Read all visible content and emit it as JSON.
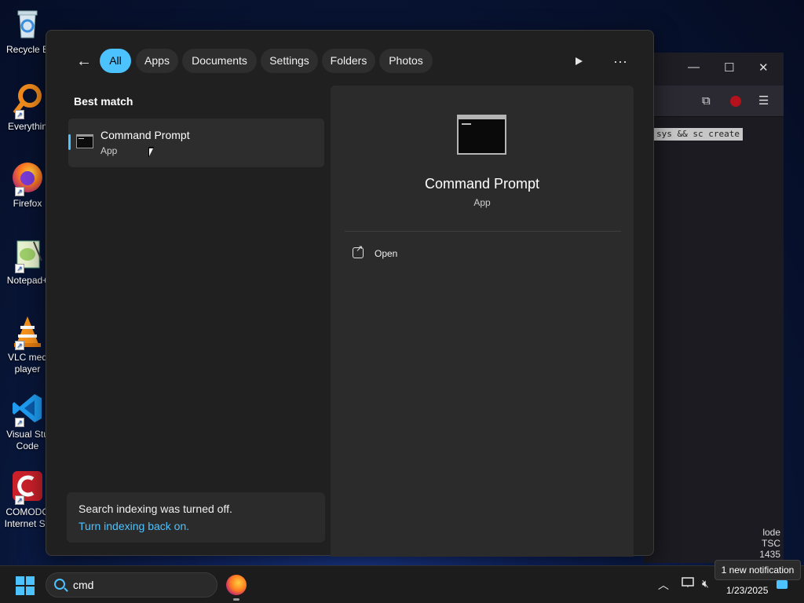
{
  "desktop": {
    "icons": [
      {
        "label": "Recycle B",
        "icon": "recycle-bin-icon"
      },
      {
        "label": "Everythin",
        "icon": "everything-search-icon"
      },
      {
        "label": "Firefox",
        "icon": "firefox-icon"
      },
      {
        "label": "Notepad+",
        "icon": "notepad-plus-plus-icon"
      },
      {
        "label": "VLC med\nplayer",
        "icon": "vlc-icon"
      },
      {
        "label": "Visual Stu\nCode",
        "icon": "vscode-icon"
      },
      {
        "label": "COMODO\nInternet Se",
        "icon": "comodo-icon"
      }
    ]
  },
  "background_window": {
    "code_text": "sys && sc create",
    "status_lines": [
      "lode",
      "TSC",
      "1435"
    ]
  },
  "search_panel": {
    "filters": [
      "All",
      "Apps",
      "Documents",
      "Settings",
      "Folders",
      "Photos"
    ],
    "active_filter": "All",
    "best_match_heading": "Best match",
    "result": {
      "title": "Command Prompt",
      "subtitle": "App"
    },
    "indexing_notice": "Search indexing was turned off.",
    "indexing_link": "Turn indexing back on.",
    "detail": {
      "title": "Command Prompt",
      "subtitle": "App",
      "open_label": "Open"
    }
  },
  "taskbar": {
    "search_value": "cmd",
    "date": "1/23/2025",
    "notification_toast": "1 new notification"
  },
  "colors": {
    "accent": "#4cc2ff",
    "panel_bg": "#202020",
    "detail_bg": "#2b2b2b"
  }
}
